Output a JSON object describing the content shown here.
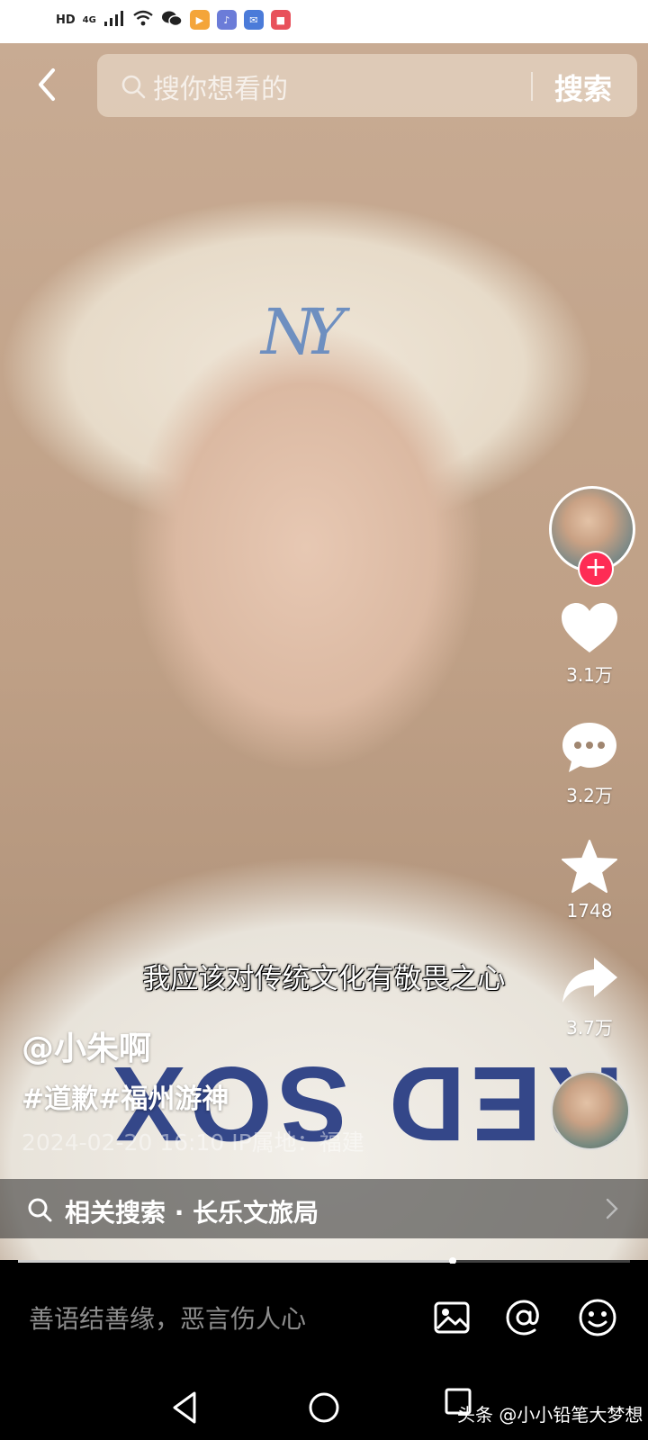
{
  "status_bar": {
    "network_label": "HD",
    "network_type": "4G"
  },
  "search": {
    "placeholder": "搜你想看的",
    "button_label": "搜索"
  },
  "video": {
    "cap_logo_text": "NY",
    "shirt_text": "RED SOX",
    "subtitle": "我应该对传统文化有敬畏之心",
    "author": "@小朱啊",
    "hashtags": "#道歉#福州游神",
    "meta": "2024-02-20 16:10  IP属地：福建",
    "progress": 0.71
  },
  "actions": {
    "likes": "3.1万",
    "comments": "3.2万",
    "favorites": "1748",
    "shares": "3.7万"
  },
  "related_search": {
    "label": "相关搜索 · 长乐文旅局"
  },
  "comment_bar": {
    "placeholder": "善语结善缘，恶言伤人心"
  },
  "watermark": "头条 @小小铅笔大梦想",
  "colors": {
    "follow_red": "#fe2c55",
    "shirt_navy": "#2b3f85",
    "cap_logo_blue": "#6e8fc0"
  }
}
